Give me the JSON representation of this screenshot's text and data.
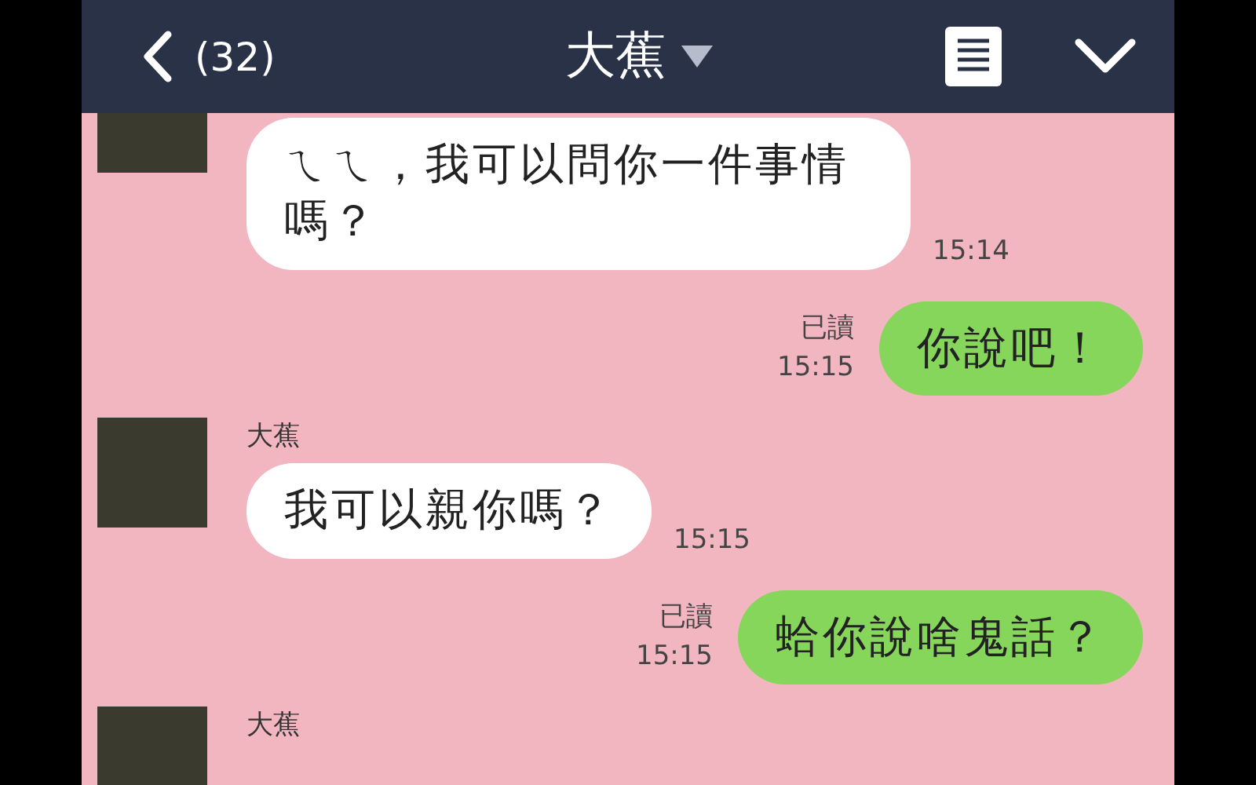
{
  "header": {
    "unread_count": "(32)",
    "title": "大蕉"
  },
  "messages": [
    {
      "kind": "incoming",
      "text": "ㄟㄟ，我可以問你一件事情嗎？",
      "time": "15:14"
    },
    {
      "kind": "outgoing",
      "read_label": "已讀",
      "text": "你說吧！",
      "time": "15:15"
    },
    {
      "kind": "incoming",
      "name": "大蕉",
      "text": "我可以親你嗎？",
      "time": "15:15"
    },
    {
      "kind": "outgoing",
      "read_label": "已讀",
      "text": "蛤你說啥鬼話？",
      "time": "15:15"
    },
    {
      "kind": "incoming",
      "name": "大蕉"
    }
  ]
}
